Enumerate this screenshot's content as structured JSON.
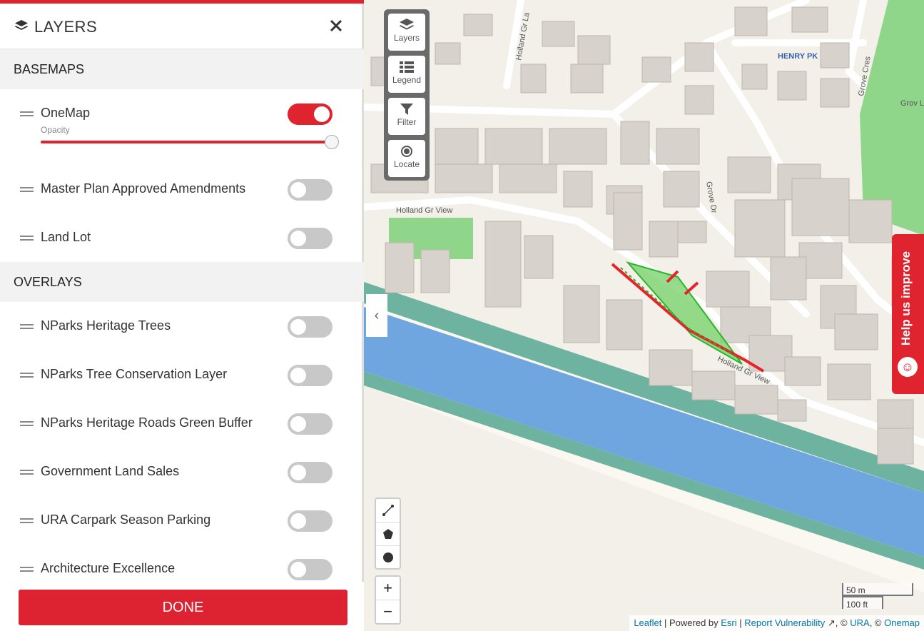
{
  "panel": {
    "title": "LAYERS",
    "close": "✕",
    "basemaps_heading": "BASEMAPS",
    "overlays_heading": "OVERLAYS",
    "basemaps": [
      {
        "label": "OneMap",
        "enabled": true,
        "opacity_label": "Opacity",
        "opacity": 1.0
      },
      {
        "label": "Master Plan Approved Amendments",
        "enabled": false
      },
      {
        "label": "Land Lot",
        "enabled": false
      }
    ],
    "overlays": [
      {
        "label": "NParks Heritage Trees",
        "enabled": false
      },
      {
        "label": "NParks Tree Conservation Layer",
        "enabled": false
      },
      {
        "label": "NParks Heritage Roads Green Buffer",
        "enabled": false
      },
      {
        "label": "Government Land Sales",
        "enabled": false
      },
      {
        "label": "URA Carpark Season Parking",
        "enabled": false
      },
      {
        "label": "Architecture Excellence",
        "enabled": false
      }
    ],
    "done_label": "DONE"
  },
  "map_tools": {
    "layers": "Layers",
    "legend": "Legend",
    "filter": "Filter",
    "locate": "Locate"
  },
  "zoom": {
    "in": "+",
    "out": "−"
  },
  "help": {
    "label": "Help us improve"
  },
  "scale": {
    "metric": "50 m",
    "imperial": "100 ft"
  },
  "attribution": {
    "leaflet": "Leaflet",
    "powered": "| Powered by",
    "esri": "Esri",
    "sep": "|",
    "report": "Report Vulnerability",
    "copy1": ", ©",
    "ura": "URA",
    "copy2": ", ©",
    "onemap": "Onemap"
  },
  "map_labels": {
    "road1": "Holland Gr View",
    "road2": "Holland Gr View",
    "road3": "Grove Dr",
    "road4": "Grove Cres",
    "road5": "Holland Gr La",
    "park": "HENRY PK",
    "grove": "Grov Lane P/G"
  },
  "colors": {
    "accent": "#e0242f",
    "water": "#6fa6e0",
    "park": "#8fd68a",
    "selection": "#7bd36f"
  }
}
